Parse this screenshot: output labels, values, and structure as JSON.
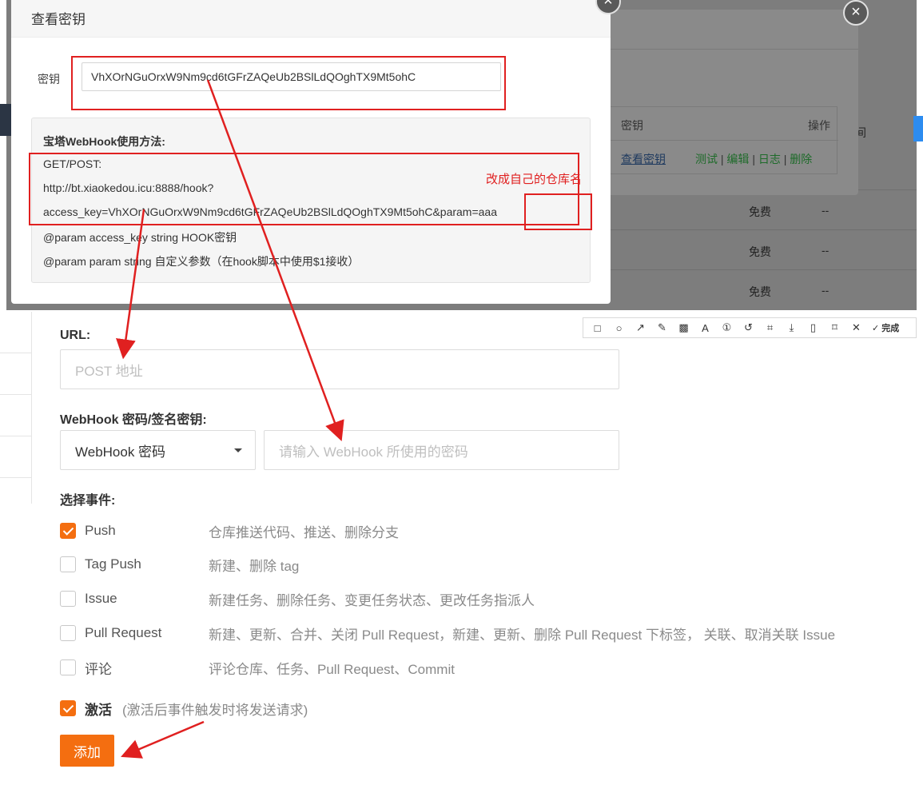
{
  "form": {
    "url_label": "URL:",
    "url_placeholder": "POST 地址",
    "secret_label": "WebHook 密码/签名密钥:",
    "secret_type_selected": "WebHook 密码",
    "secret_placeholder": "请输入 WebHook 所使用的密码",
    "events_label": "选择事件:",
    "events": [
      {
        "name": "Push",
        "desc": "仓库推送代码、推送、删除分支",
        "checked": true
      },
      {
        "name": "Tag Push",
        "desc": "新建、删除 tag",
        "checked": false
      },
      {
        "name": "Issue",
        "desc": "新建任务、删除任务、变更任务状态、更改任务指派人",
        "checked": false
      },
      {
        "name": "Pull Request",
        "desc": "新建、更新、合并、关闭 Pull Request，新建、更新、删除 Pull Request 下标签， 关联、取消关联 Issue",
        "checked": false
      },
      {
        "name": "评论",
        "desc": "评论仓库、任务、Pull Request、Commit",
        "checked": false
      }
    ],
    "activate_label": "激活",
    "activate_note": "(激活后事件触发时将发送请求)",
    "activate_checked": true,
    "add_button": "添加"
  },
  "background_table": {
    "rows": [
      {
        "price": "免费",
        "value": "--"
      },
      {
        "price": "免费",
        "value": "--"
      },
      {
        "price": "免费",
        "value": "--"
      }
    ],
    "partial_header": "间"
  },
  "back_modal": {
    "col_key": "密钥",
    "col_ops": "操作",
    "view_key_link": "查看密钥",
    "ops": [
      "测试",
      "编辑",
      "日志",
      "删除"
    ],
    "close": "×"
  },
  "modal": {
    "title": "查看密钥",
    "key_label": "密钥",
    "key_value": "VhXOrNGuOrxW9Nm9cd6tGFrZAQeUb2BSlLdQOghTX9Mt5ohC",
    "help_title": "宝塔WebHook使用方法:",
    "help_lines": [
      "GET/POST:",
      "http://bt.xiaokedou.icu:8888/hook?",
      "access_key=VhXOrNGuOrxW9Nm9cd6tGFrZAQeUb2BSlLdQOghTX9Mt5ohC&param=aaa",
      "@param access_key string HOOK密钥",
      "@param param string 自定义参数（在hook脚本中使用$1接收）"
    ],
    "close": "×"
  },
  "annotation": {
    "note": "改成自己的仓库名",
    "color": "#e02020"
  },
  "toolbar": {
    "icons": [
      "rectangle-icon",
      "ellipse-icon",
      "arrow-icon",
      "pen-icon",
      "mosaic-icon",
      "text-icon",
      "number-icon",
      "undo-icon",
      "crop-icon",
      "download-icon",
      "pin-icon",
      "bookmark-icon",
      "cancel-icon"
    ],
    "done_label": "完成"
  },
  "colors": {
    "accent": "#f46e10",
    "link_green": "#1e6b2a",
    "annotation_red": "#e02020"
  }
}
